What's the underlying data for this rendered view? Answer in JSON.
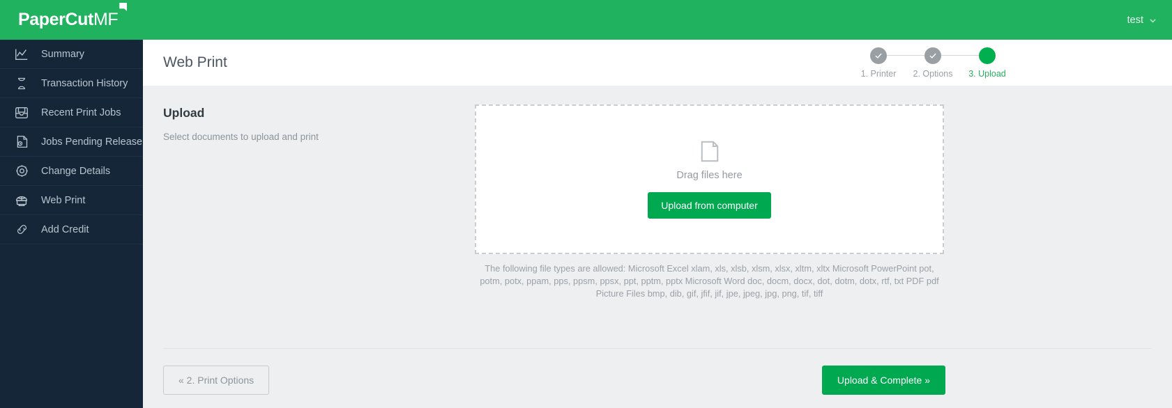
{
  "brand": {
    "name_bold": "PaperCut",
    "name_light": "MF",
    "header_color": "#21b260"
  },
  "user_menu": {
    "label": "test",
    "chevron_icon": "chevron-down-icon"
  },
  "sidebar": {
    "background": "#142638",
    "items": [
      {
        "label": "Summary",
        "icon": "chart-line-icon"
      },
      {
        "label": "Transaction History",
        "icon": "hourglass-icon"
      },
      {
        "label": "Recent Print Jobs",
        "icon": "printer-tray-icon"
      },
      {
        "label": "Jobs Pending Release",
        "icon": "document-clock-icon"
      },
      {
        "label": "Change Details",
        "icon": "gear-icon"
      },
      {
        "label": "Web Print",
        "icon": "web-printer-icon"
      },
      {
        "label": "Add Credit",
        "icon": "link-chain-icon"
      }
    ]
  },
  "page": {
    "title": "Web Print"
  },
  "wizard": {
    "steps": [
      {
        "label": "1. Printer",
        "state": "done"
      },
      {
        "label": "2. Options",
        "state": "done"
      },
      {
        "label": "3. Upload",
        "state": "active"
      }
    ],
    "done_color": "#9a9fa4",
    "active_color": "#00b050"
  },
  "upload": {
    "heading": "Upload",
    "subheading": "Select documents to upload and print",
    "dropzone": {
      "file_icon": "document-page-icon",
      "drag_text": "Drag files here",
      "button_label": "Upload from computer"
    },
    "file_types_text": "The following file types are allowed: Microsoft Excel xlam, xls, xlsb, xlsm, xlsx, xltm, xltx Microsoft PowerPoint pot, potm, potx, ppam, pps, ppsm, ppsx, ppt, pptm, pptx Microsoft Word doc, docm, docx, dot, dotm, dotx, rtf, txt PDF pdf Picture Files bmp, dib, gif, jfif, jif, jpe, jpeg, jpg, png, tif, tiff"
  },
  "footer": {
    "back_label": "« 2. Print Options",
    "submit_label": "Upload & Complete »"
  }
}
